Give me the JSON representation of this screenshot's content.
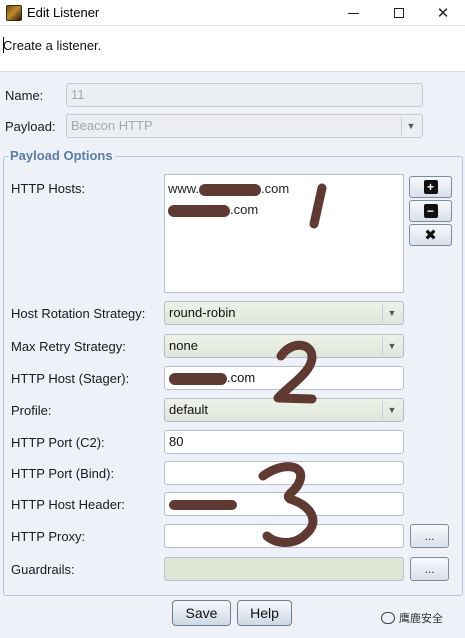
{
  "window": {
    "title": "Edit Listener",
    "minimize_icon": "minimize-icon",
    "maximize_icon": "maximize-icon",
    "close_icon": "close-icon",
    "close_glyph": "✕"
  },
  "description": "Create a listener.",
  "form": {
    "name": {
      "label": "Name:",
      "value": "11"
    },
    "payload": {
      "label": "Payload:",
      "value": "Beacon HTTP"
    },
    "section_title": "Payload Options",
    "http_hosts": {
      "label": "HTTP Hosts:",
      "entries": [
        {
          "prefix": "www.",
          "suffix": ".com"
        },
        {
          "prefix": "",
          "suffix": ".com"
        }
      ],
      "add_glyph": "+",
      "remove_glyph": "−",
      "clear_glyph": "✖"
    },
    "host_rotation": {
      "label": "Host Rotation Strategy:",
      "value": "round-robin"
    },
    "max_retry": {
      "label": "Max Retry Strategy:",
      "value": "none"
    },
    "http_host_stager": {
      "label": "HTTP Host (Stager):",
      "suffix": ".com"
    },
    "profile": {
      "label": "Profile:",
      "value": "default"
    },
    "http_port_c2": {
      "label": "HTTP Port (C2):",
      "value": "80"
    },
    "http_port_bind": {
      "label": "HTTP Port (Bind):",
      "value": ""
    },
    "http_host_header": {
      "label": "HTTP Host Header:",
      "value": ""
    },
    "http_proxy": {
      "label": "HTTP Proxy:",
      "value": "",
      "button_label": "..."
    },
    "guardrails": {
      "label": "Guardrails:",
      "value": "",
      "button_label": "..."
    }
  },
  "buttons": {
    "save": "Save",
    "help": "Help"
  },
  "watermark": "鹰鹿安全",
  "colors": {
    "panel_bg": "#eef1f7",
    "section_title": "#5a7caa",
    "annotation_brown": "#5e3a32"
  }
}
